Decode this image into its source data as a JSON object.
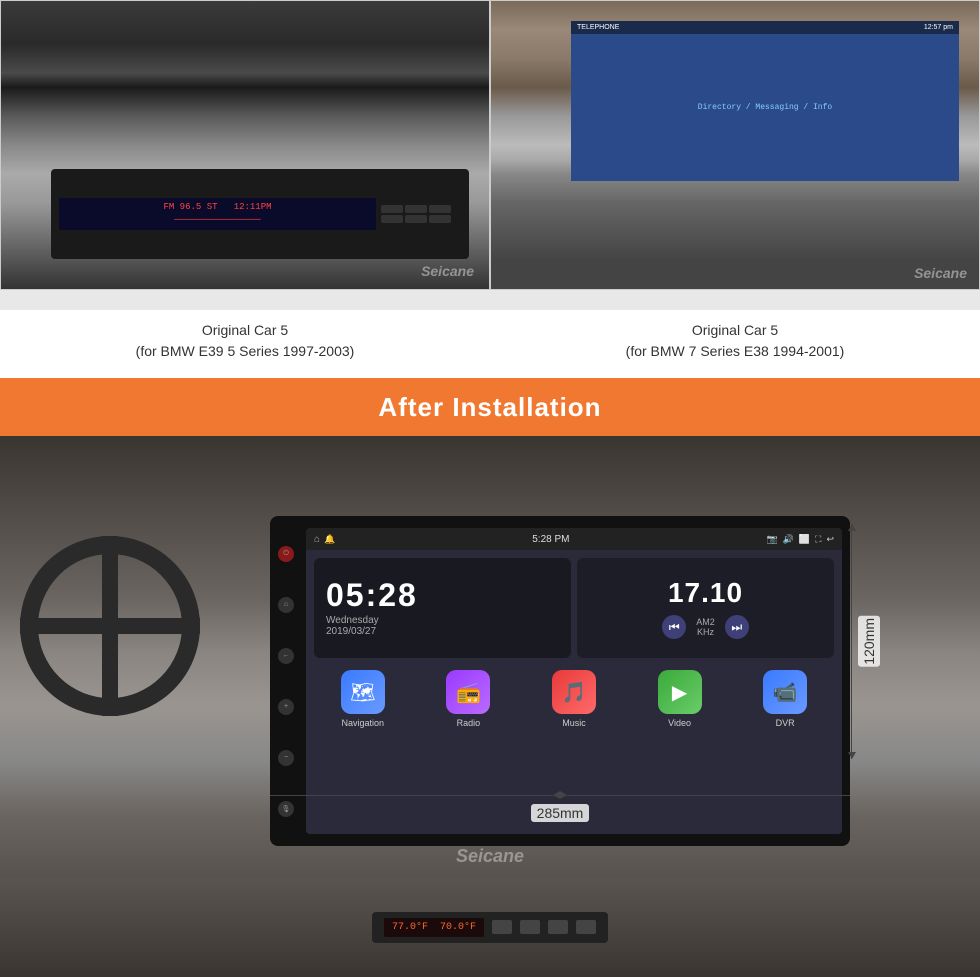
{
  "topImages": {
    "left": {
      "caption_line1": "Original Car 5",
      "caption_line2": "(for BMW E39 5 Series 1997-2003)"
    },
    "right": {
      "caption_line1": "Original Car 5",
      "caption_line2": "(for BMW 7 Series E38 1994-2001)"
    }
  },
  "banner": {
    "text": "After Installation"
  },
  "headUnit": {
    "topbar": {
      "time": "5:28 PM"
    },
    "clock": {
      "time": "05:28",
      "day": "Wednesday",
      "date": "2019/03/27"
    },
    "radio": {
      "freq": "17.10",
      "band": "AM2",
      "unit": "KHz"
    },
    "apps": [
      {
        "name": "Navigation",
        "icon_type": "nav"
      },
      {
        "name": "Radio",
        "icon_type": "radio"
      },
      {
        "name": "Music",
        "icon_type": "music"
      },
      {
        "name": "Video",
        "icon_type": "video"
      },
      {
        "name": "DVR",
        "icon_type": "dvr"
      }
    ]
  },
  "dimensions": {
    "width": "285mm",
    "height": "120mm"
  },
  "watermark": "Seicane"
}
